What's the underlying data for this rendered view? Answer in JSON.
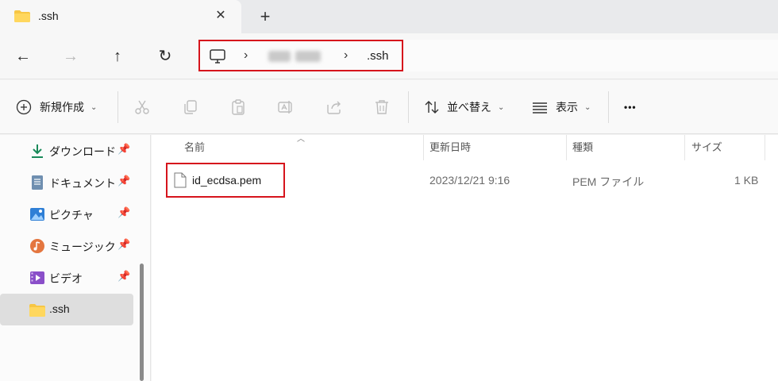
{
  "tab": {
    "title": ".ssh",
    "close_glyph": "✕",
    "new_tab_glyph": "+"
  },
  "nav": {
    "back_glyph": "←",
    "forward_glyph": "→",
    "up_glyph": "↑",
    "refresh_glyph": "↻",
    "breadcrumb_sep": "›",
    "breadcrumb_last": ".ssh"
  },
  "commands": {
    "new_label": "新規作成",
    "sort_label": "並べ替え",
    "view_label": "表示",
    "more_glyph": "•••",
    "chevron": "⌄"
  },
  "sidebar": {
    "items": [
      {
        "label": "ダウンロード",
        "icon": "download-icon",
        "pinned": true
      },
      {
        "label": "ドキュメント",
        "icon": "document-icon",
        "pinned": true
      },
      {
        "label": "ピクチャ",
        "icon": "pictures-icon",
        "pinned": true
      },
      {
        "label": "ミュージック",
        "icon": "music-icon",
        "pinned": true
      },
      {
        "label": "ビデオ",
        "icon": "video-icon",
        "pinned": true
      },
      {
        "label": ".ssh",
        "icon": "folder-icon",
        "pinned": false,
        "selected": true
      }
    ]
  },
  "columns": {
    "name": "名前",
    "modified": "更新日時",
    "type": "種類",
    "size": "サイズ"
  },
  "files": [
    {
      "name": "id_ecdsa.pem",
      "modified": "2023/12/21 9:16",
      "type": "PEM ファイル",
      "size": "1 KB"
    }
  ],
  "colors": {
    "highlight": "#d6141c",
    "accent": "#0067c0",
    "folder": "#f7c644"
  }
}
